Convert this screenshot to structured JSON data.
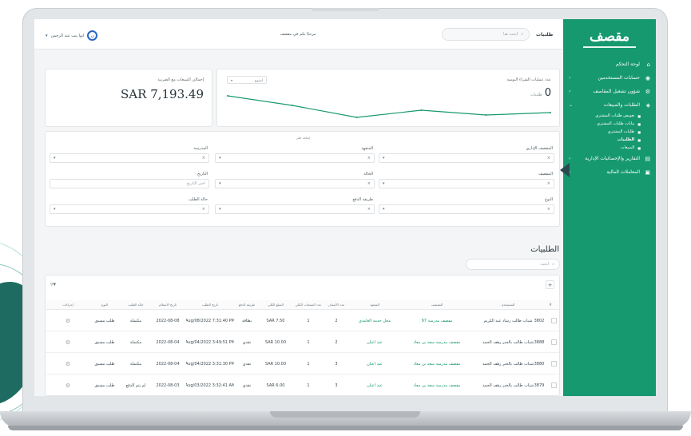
{
  "colors": {
    "brand": "#16996e",
    "accent": "#2a64c8",
    "sidebar_pointer": "#2a4a50",
    "decor": "#1e6b61"
  },
  "sidebar": {
    "logo": "مقصف",
    "items": [
      {
        "label": "لوحة التحكم",
        "icon": "home-icon"
      },
      {
        "label": "حسابات المستخدمين",
        "icon": "users-icon",
        "chevron": "‹"
      },
      {
        "label": "شؤون تشغيل المقاصف",
        "icon": "settings-icon",
        "chevron": "‹"
      },
      {
        "label": "الطلبات والمبيعات",
        "icon": "cart-icon",
        "chevron": "⌄"
      }
    ],
    "subitems": [
      {
        "label": "تعويض طلبات المشتري"
      },
      {
        "label": "بيانات طلبات المشتري"
      },
      {
        "label": "طلبات المشتري"
      },
      {
        "label": "الطلبيات",
        "active": true
      },
      {
        "label": "المبيعات"
      }
    ],
    "items_after": [
      {
        "label": "التقارير والإحصائيات الإدارية",
        "icon": "report-icon",
        "chevron": "‹"
      },
      {
        "label": "المعاملات المالية",
        "icon": "wallet-icon",
        "chevron": "‹"
      }
    ]
  },
  "topbar": {
    "user_label": "ايوا بنت عبد الرحمن",
    "avatar_glyph": "ن",
    "welcome": "مرحبًا بكم في مقصف",
    "search_placeholder": "ابحث هنا",
    "menu_label": "طلبيات"
  },
  "stats": {
    "total_label": "إجمالي المبيعات مع الضريبة",
    "total_value": "SAR 7,193.49",
    "chart_title": "عدد عمليات الشراء اليومية",
    "chart_value": "0",
    "chart_unit": "طلبيات",
    "chart_range": "أسبوع",
    "chart_select_icon": "chevron-down-icon"
  },
  "chart_data": {
    "type": "line",
    "title": "عدد عمليات الشراء اليومية",
    "xlabel": "",
    "ylabel": "",
    "x": [
      1,
      2,
      3,
      4,
      5,
      6
    ],
    "values": [
      10,
      6,
      1,
      4,
      2,
      3
    ]
  },
  "filters": {
    "heading": "إضافة فلتر",
    "fields": [
      {
        "label": "المقصف الإداري",
        "value": "",
        "placeholder": ""
      },
      {
        "label": "المتعهد",
        "value": "",
        "placeholder": ""
      },
      {
        "label": "المدرسة",
        "value": "",
        "placeholder": ""
      },
      {
        "label": "المقصف",
        "value": "",
        "placeholder": ""
      },
      {
        "label": "الحالة",
        "value": "",
        "placeholder": ""
      },
      {
        "label": "التاريخ",
        "value": "",
        "placeholder": "اختر التاريخ"
      },
      {
        "label": "النوع",
        "value": "",
        "placeholder": ""
      },
      {
        "label": "طريقة الدفع",
        "value": "",
        "placeholder": ""
      },
      {
        "label": "حالة الطلب",
        "value": "",
        "placeholder": ""
      }
    ]
  },
  "orders": {
    "title": "الطلبيات",
    "search_placeholder": "ابحث",
    "columns": [
      "#",
      "المستخدم",
      "المقصف",
      "المتعهد",
      "عدد الأصناف",
      "عدد المنتجات الكلي",
      "المبلغ الكلي",
      "طريقة الدفع",
      "تاريخ الطلب",
      "تاريخ الاستلام",
      "حالة الطلب",
      "النوع",
      "إجراءات"
    ],
    "rows": [
      {
        "id": "3802",
        "user": "شباب طالب رشاد عبد الكريم",
        "canteen": "مقصف مدرسة 97",
        "vendor": "محل خدمة الغامدي",
        "items": "2",
        "total_qty": "1",
        "amount": "SAR 7.50",
        "payment": "بطاقة",
        "date": "Aug/08/2022 7:31:40 PM",
        "pickup": "2022-08-08",
        "status": "مكتملة",
        "type": "طلب مسبق"
      },
      {
        "id": "3888",
        "user": "شباب طالب بالخبر رهف الحمد",
        "canteen": "مقصف مدرسة سعد بن معاذ",
        "vendor": "عبد اعيان",
        "items": "2",
        "total_qty": "1",
        "amount": "SAR 10.00",
        "payment": "نقدي",
        "date": "Aug/04/2022 3:49:51 PM",
        "pickup": "2022-08-04",
        "status": "مكتملة",
        "type": "طلب مسبق"
      },
      {
        "id": "3880",
        "user": "شباب طالب بالخبر رهف الحمد",
        "canteen": "مقصف مدرسة سعد بن معاذ",
        "vendor": "عبد اعيان",
        "items": "3",
        "total_qty": "1",
        "amount": "SAR 10.00",
        "payment": "نقدي",
        "date": "Aug/04/2022 3:31:30 PM",
        "pickup": "2022-08-04",
        "status": "مكتملة",
        "type": "طلب مسبق"
      },
      {
        "id": "3879",
        "user": "شباب طالب بالخبر رهف الحمد",
        "canteen": "مقصف مدرسة سعد بن معاذ",
        "vendor": "عبد اعيان",
        "items": "3",
        "total_qty": "1",
        "amount": "SAR 6.00",
        "payment": "نقدي",
        "date": "Aug/03/2022 3:32:41 AM",
        "pickup": "2022-08-03",
        "status": "لم يتم الدفع",
        "type": "طلب مسبق"
      }
    ]
  }
}
